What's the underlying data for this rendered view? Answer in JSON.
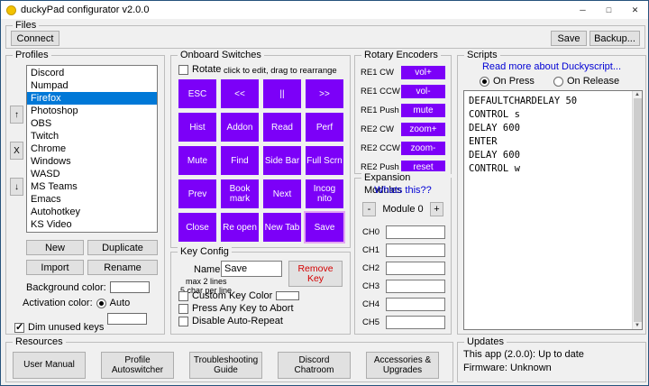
{
  "window": {
    "title": "duckyPad configurator v2.0.0",
    "minimize": "─",
    "maximize": "□",
    "close": "✕"
  },
  "colors": {
    "key_purple": "#7c00f8",
    "selection_blue": "#0078d7",
    "link_blue": "#0000d4",
    "remove_red": "#d40000"
  },
  "files": {
    "title": "Files",
    "connect_label": "Connect",
    "save_label": "Save",
    "backup_label": "Backup..."
  },
  "profiles": {
    "title": "Profiles",
    "items": [
      "Discord",
      "Numpad",
      "Firefox",
      "Photoshop",
      "OBS",
      "Twitch",
      "Chrome",
      "Windows",
      "WASD",
      "MS Teams",
      "Emacs",
      "Autohotkey",
      "KS Video"
    ],
    "selected_item": "Firefox",
    "move_up_label": "↑",
    "delete_label": "X",
    "move_down_label": "↓",
    "new_label": "New",
    "duplicate_label": "Duplicate",
    "import_label": "Import",
    "rename_label": "Rename",
    "background_color_label": "Background color:",
    "activation_color_label": "Activation color:",
    "auto_label": "Auto",
    "dim_unused_label": "Dim unused keys"
  },
  "onboard_switches": {
    "title": "Onboard Switches",
    "rotate_label": "Rotate",
    "hint": "click to edit, drag to rearrange",
    "keys": [
      "ESC",
      "<<",
      "||",
      ">>",
      "Hist",
      "Addon",
      "Read",
      "Perf",
      "Mute",
      "Find",
      "Side Bar",
      "Full Scrn",
      "Prev",
      "Book mark",
      "Next",
      "Incog nito",
      "Close",
      "Re open",
      "New Tab",
      "Save"
    ],
    "selected_key": "Save"
  },
  "key_config": {
    "title": "Key Config",
    "name_label": "Name:",
    "hint_line1": "max 2 lines",
    "hint_line2": "5 char per line",
    "name_value": "Save",
    "remove_label": "Remove Key",
    "custom_color_label": "Custom Key Color",
    "abort_label": "Press Any Key to Abort",
    "autorepeat_label": "Disable Auto-Repeat"
  },
  "rotary_encoders": {
    "title": "Rotary Encoders",
    "rows": [
      {
        "label": "RE1 CW",
        "action": "vol+"
      },
      {
        "label": "RE1 CCW",
        "action": "vol-"
      },
      {
        "label": "RE1 Push",
        "action": "mute"
      },
      {
        "label": "RE2 CW",
        "action": "zoom+"
      },
      {
        "label": "RE2 CCW",
        "action": "zoom-"
      },
      {
        "label": "RE2 Push",
        "action": "reset"
      }
    ]
  },
  "expansion_modules": {
    "title": "Expansion Modules",
    "link": "Whats this??",
    "minus_label": "-",
    "module_label": "Module 0",
    "plus_label": "+",
    "channels": [
      "CH0",
      "CH1",
      "CH2",
      "CH3",
      "CH4",
      "CH5"
    ]
  },
  "scripts": {
    "title": "Scripts",
    "link": "Read more about Duckyscript...",
    "on_press_label": "On Press",
    "on_release_label": "On Release",
    "code": "DEFAULTCHARDELAY 50\nCONTROL s\nDELAY 600\nENTER\nDELAY 600\nCONTROL w"
  },
  "resources": {
    "title": "Resources",
    "buttons": [
      "User Manual",
      "Profile Autoswitcher",
      "Troubleshooting Guide",
      "Discord Chatroom",
      "Accessories & Upgrades"
    ]
  },
  "updates": {
    "title": "Updates",
    "app_status": "This app (2.0.0): Up to date",
    "firmware_status": "Firmware: Unknown"
  }
}
